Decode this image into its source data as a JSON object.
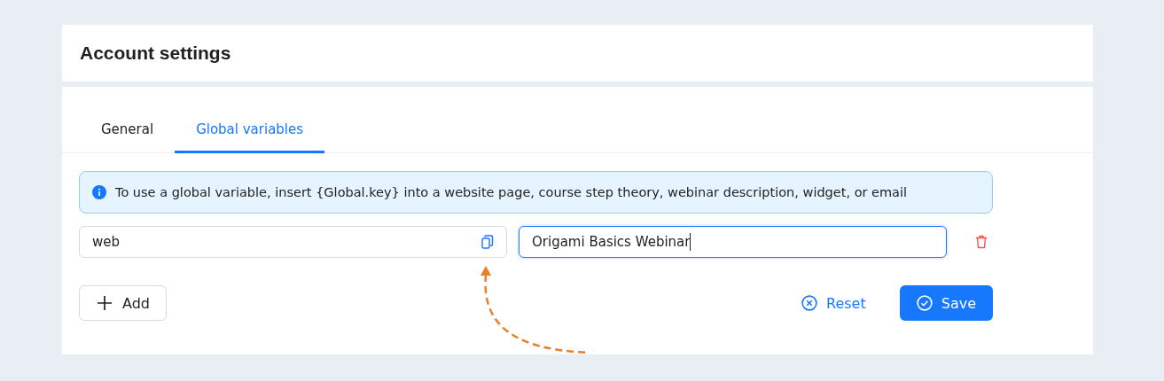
{
  "header": {
    "title": "Account settings"
  },
  "tabs": [
    {
      "label": "General",
      "selected": false
    },
    {
      "label": "Global variables",
      "selected": true
    }
  ],
  "info": {
    "text": "To use a global variable, insert {Global.key} into a website page, course step theory, webinar description, widget, or email"
  },
  "variables": [
    {
      "key": "web",
      "value": "Origami Basics Webinar",
      "focused": true
    }
  ],
  "buttons": {
    "add": "Add",
    "reset": "Reset",
    "save": "Save"
  }
}
